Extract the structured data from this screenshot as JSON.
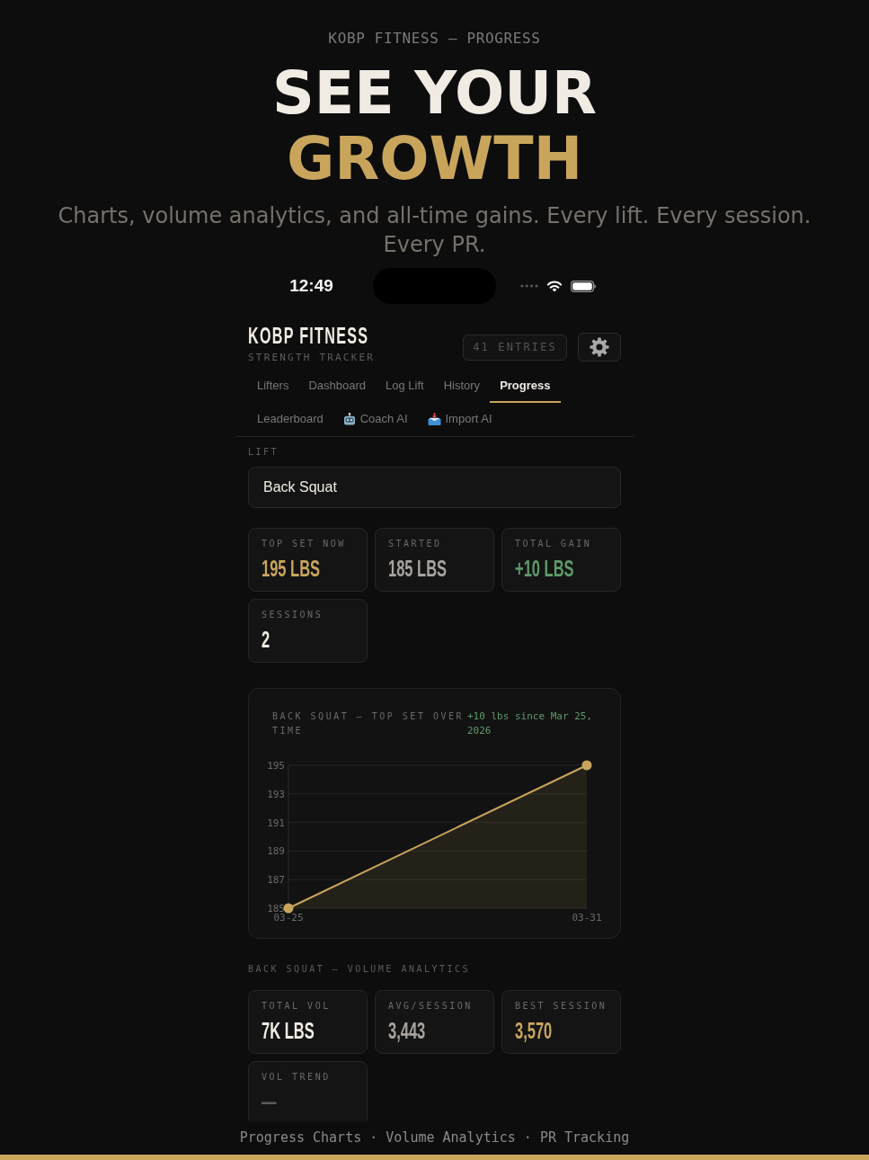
{
  "hero": {
    "eyebrow": "KOBP FITNESS — PROGRESS",
    "headline": [
      {
        "text": "SEE YOUR",
        "accent": false
      },
      {
        "text": "GROWTH",
        "accent": true
      }
    ],
    "subtitle": "Charts, volume analytics, and all-time gains. Every lift. Every session. Every PR."
  },
  "status_bar": {
    "time": "12:49"
  },
  "app_header": {
    "title": "KOBP FITNESS",
    "subtitle": "STRENGTH TRACKER",
    "entries_badge": "41 ENTRIES"
  },
  "tabs": [
    {
      "label": "Lifters",
      "kind": "plain",
      "selected": false
    },
    {
      "label": "Dashboard",
      "kind": "plain",
      "selected": false
    },
    {
      "label": "Log Lift",
      "kind": "plain",
      "selected": false
    },
    {
      "label": "History",
      "kind": "plain",
      "selected": false
    },
    {
      "label": "Progress",
      "kind": "plain",
      "selected": true
    },
    {
      "label": "Leaderboard",
      "kind": "plain",
      "selected": false
    },
    {
      "label": "Coach AI",
      "kind": "coach",
      "selected": false
    },
    {
      "label": "Import AI",
      "kind": "import",
      "selected": false
    }
  ],
  "lift": {
    "label": "LIFT",
    "value": "Back Squat"
  },
  "stats": [
    {
      "label": "TOP SET NOW",
      "value": "195 LBS",
      "color": "#c9a55c"
    },
    {
      "label": "STARTED",
      "value": "185 LBS",
      "color": "#a8a29e"
    },
    {
      "label": "TOTAL GAIN",
      "value": "+10 LBS",
      "color": "#5f9a6b"
    },
    {
      "label": "SESSIONS",
      "value": "2",
      "color": "#f0ece4"
    }
  ],
  "chart_card": {
    "note": "+10 lbs since Mar 25, 2026",
    "chart_data": {
      "type": "area",
      "title": "BACK SQUAT — TOP SET OVER TIME",
      "categories": [
        "03-25",
        "03-31"
      ],
      "series": [
        {
          "color": "#c9a55c",
          "values": [
            185,
            195
          ]
        }
      ],
      "ylim": [
        185,
        195
      ],
      "yticks": [
        185,
        187,
        189,
        191,
        193,
        195
      ]
    }
  },
  "volume": {
    "title": "BACK SQUAT — VOLUME ANALYTICS",
    "stats": [
      {
        "label": "TOTAL VOL",
        "value": "7K LBS",
        "color": "#f0ece4"
      },
      {
        "label": "AVG/SESSION",
        "value": "3,443",
        "color": "#a8a29e"
      },
      {
        "label": "BEST SESSION",
        "value": "3,570",
        "color": "#c9a55c"
      },
      {
        "label": "VOL TREND",
        "value": "—",
        "color": "#5a5a5a"
      }
    ]
  },
  "footer": "Progress Charts · Volume Analytics · PR Tracking"
}
